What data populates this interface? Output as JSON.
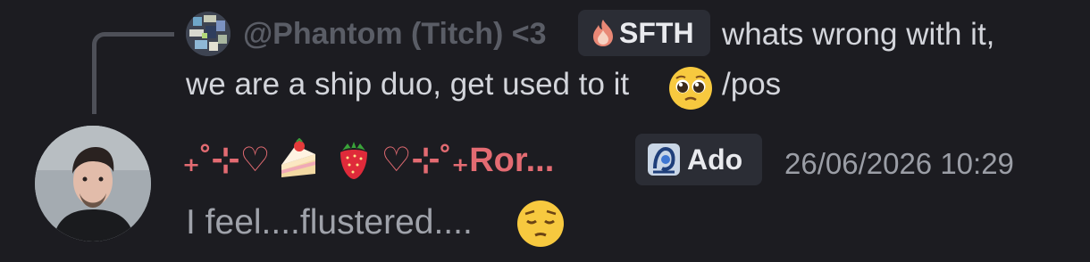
{
  "reply": {
    "author": "@Phantom (Titch) <3",
    "tag_label": "SFTH",
    "tag_icon": "flame-icon",
    "text_line1": "whats wrong with it,",
    "text_line2": "we are a ship duo, get used to it",
    "emoji": "pleading-face-emoji",
    "text_suffix": "/pos"
  },
  "message": {
    "username_prefix": "₊˚⊹♡",
    "username_emoji_1": "shortcake-emoji",
    "username_emoji_2": "strawberry-emoji",
    "username_suffix": "♡⊹˚₊Ror...",
    "tag_label": "Ado",
    "tag_icon": "ado-icon",
    "timestamp": "26/06/2026 10:29",
    "text": "I feel....flustered....",
    "emoji": "pensive-face-emoji"
  },
  "colors": {
    "background": "#1c1c21",
    "username": "#e36b72",
    "reply_author": "#5a5d66",
    "tag_background": "#2b2d35",
    "timestamp": "#9b9ea6",
    "message_text": "#9fa2aa"
  }
}
